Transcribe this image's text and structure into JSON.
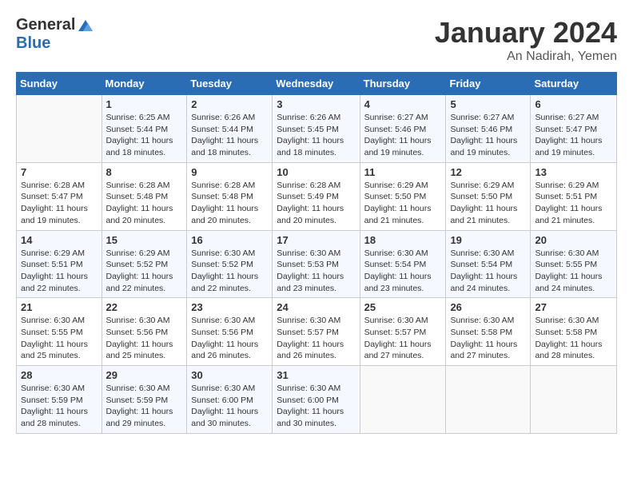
{
  "header": {
    "logo_general": "General",
    "logo_blue": "Blue",
    "month_title": "January 2024",
    "location": "An Nadirah, Yemen"
  },
  "weekdays": [
    "Sunday",
    "Monday",
    "Tuesday",
    "Wednesday",
    "Thursday",
    "Friday",
    "Saturday"
  ],
  "weeks": [
    [
      {
        "day": "",
        "sunrise": "",
        "sunset": "",
        "daylight": ""
      },
      {
        "day": "1",
        "sunrise": "Sunrise: 6:25 AM",
        "sunset": "Sunset: 5:44 PM",
        "daylight": "Daylight: 11 hours and 18 minutes."
      },
      {
        "day": "2",
        "sunrise": "Sunrise: 6:26 AM",
        "sunset": "Sunset: 5:44 PM",
        "daylight": "Daylight: 11 hours and 18 minutes."
      },
      {
        "day": "3",
        "sunrise": "Sunrise: 6:26 AM",
        "sunset": "Sunset: 5:45 PM",
        "daylight": "Daylight: 11 hours and 18 minutes."
      },
      {
        "day": "4",
        "sunrise": "Sunrise: 6:27 AM",
        "sunset": "Sunset: 5:46 PM",
        "daylight": "Daylight: 11 hours and 19 minutes."
      },
      {
        "day": "5",
        "sunrise": "Sunrise: 6:27 AM",
        "sunset": "Sunset: 5:46 PM",
        "daylight": "Daylight: 11 hours and 19 minutes."
      },
      {
        "day": "6",
        "sunrise": "Sunrise: 6:27 AM",
        "sunset": "Sunset: 5:47 PM",
        "daylight": "Daylight: 11 hours and 19 minutes."
      }
    ],
    [
      {
        "day": "7",
        "sunrise": "Sunrise: 6:28 AM",
        "sunset": "Sunset: 5:47 PM",
        "daylight": "Daylight: 11 hours and 19 minutes."
      },
      {
        "day": "8",
        "sunrise": "Sunrise: 6:28 AM",
        "sunset": "Sunset: 5:48 PM",
        "daylight": "Daylight: 11 hours and 20 minutes."
      },
      {
        "day": "9",
        "sunrise": "Sunrise: 6:28 AM",
        "sunset": "Sunset: 5:48 PM",
        "daylight": "Daylight: 11 hours and 20 minutes."
      },
      {
        "day": "10",
        "sunrise": "Sunrise: 6:28 AM",
        "sunset": "Sunset: 5:49 PM",
        "daylight": "Daylight: 11 hours and 20 minutes."
      },
      {
        "day": "11",
        "sunrise": "Sunrise: 6:29 AM",
        "sunset": "Sunset: 5:50 PM",
        "daylight": "Daylight: 11 hours and 21 minutes."
      },
      {
        "day": "12",
        "sunrise": "Sunrise: 6:29 AM",
        "sunset": "Sunset: 5:50 PM",
        "daylight": "Daylight: 11 hours and 21 minutes."
      },
      {
        "day": "13",
        "sunrise": "Sunrise: 6:29 AM",
        "sunset": "Sunset: 5:51 PM",
        "daylight": "Daylight: 11 hours and 21 minutes."
      }
    ],
    [
      {
        "day": "14",
        "sunrise": "Sunrise: 6:29 AM",
        "sunset": "Sunset: 5:51 PM",
        "daylight": "Daylight: 11 hours and 22 minutes."
      },
      {
        "day": "15",
        "sunrise": "Sunrise: 6:29 AM",
        "sunset": "Sunset: 5:52 PM",
        "daylight": "Daylight: 11 hours and 22 minutes."
      },
      {
        "day": "16",
        "sunrise": "Sunrise: 6:30 AM",
        "sunset": "Sunset: 5:52 PM",
        "daylight": "Daylight: 11 hours and 22 minutes."
      },
      {
        "day": "17",
        "sunrise": "Sunrise: 6:30 AM",
        "sunset": "Sunset: 5:53 PM",
        "daylight": "Daylight: 11 hours and 23 minutes."
      },
      {
        "day": "18",
        "sunrise": "Sunrise: 6:30 AM",
        "sunset": "Sunset: 5:54 PM",
        "daylight": "Daylight: 11 hours and 23 minutes."
      },
      {
        "day": "19",
        "sunrise": "Sunrise: 6:30 AM",
        "sunset": "Sunset: 5:54 PM",
        "daylight": "Daylight: 11 hours and 24 minutes."
      },
      {
        "day": "20",
        "sunrise": "Sunrise: 6:30 AM",
        "sunset": "Sunset: 5:55 PM",
        "daylight": "Daylight: 11 hours and 24 minutes."
      }
    ],
    [
      {
        "day": "21",
        "sunrise": "Sunrise: 6:30 AM",
        "sunset": "Sunset: 5:55 PM",
        "daylight": "Daylight: 11 hours and 25 minutes."
      },
      {
        "day": "22",
        "sunrise": "Sunrise: 6:30 AM",
        "sunset": "Sunset: 5:56 PM",
        "daylight": "Daylight: 11 hours and 25 minutes."
      },
      {
        "day": "23",
        "sunrise": "Sunrise: 6:30 AM",
        "sunset": "Sunset: 5:56 PM",
        "daylight": "Daylight: 11 hours and 26 minutes."
      },
      {
        "day": "24",
        "sunrise": "Sunrise: 6:30 AM",
        "sunset": "Sunset: 5:57 PM",
        "daylight": "Daylight: 11 hours and 26 minutes."
      },
      {
        "day": "25",
        "sunrise": "Sunrise: 6:30 AM",
        "sunset": "Sunset: 5:57 PM",
        "daylight": "Daylight: 11 hours and 27 minutes."
      },
      {
        "day": "26",
        "sunrise": "Sunrise: 6:30 AM",
        "sunset": "Sunset: 5:58 PM",
        "daylight": "Daylight: 11 hours and 27 minutes."
      },
      {
        "day": "27",
        "sunrise": "Sunrise: 6:30 AM",
        "sunset": "Sunset: 5:58 PM",
        "daylight": "Daylight: 11 hours and 28 minutes."
      }
    ],
    [
      {
        "day": "28",
        "sunrise": "Sunrise: 6:30 AM",
        "sunset": "Sunset: 5:59 PM",
        "daylight": "Daylight: 11 hours and 28 minutes."
      },
      {
        "day": "29",
        "sunrise": "Sunrise: 6:30 AM",
        "sunset": "Sunset: 5:59 PM",
        "daylight": "Daylight: 11 hours and 29 minutes."
      },
      {
        "day": "30",
        "sunrise": "Sunrise: 6:30 AM",
        "sunset": "Sunset: 6:00 PM",
        "daylight": "Daylight: 11 hours and 30 minutes."
      },
      {
        "day": "31",
        "sunrise": "Sunrise: 6:30 AM",
        "sunset": "Sunset: 6:00 PM",
        "daylight": "Daylight: 11 hours and 30 minutes."
      },
      {
        "day": "",
        "sunrise": "",
        "sunset": "",
        "daylight": ""
      },
      {
        "day": "",
        "sunrise": "",
        "sunset": "",
        "daylight": ""
      },
      {
        "day": "",
        "sunrise": "",
        "sunset": "",
        "daylight": ""
      }
    ]
  ]
}
